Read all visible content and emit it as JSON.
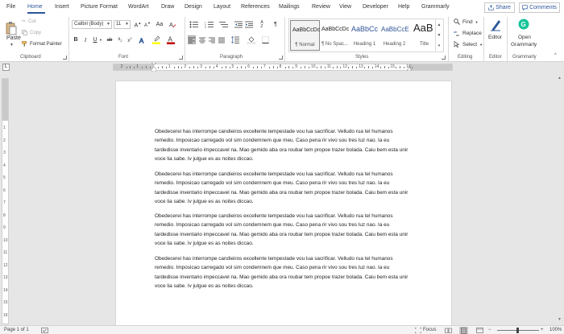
{
  "tabs": [
    "File",
    "Home",
    "Insert",
    "Picture Format",
    "WordArt",
    "Draw",
    "Design",
    "Layout",
    "References",
    "Mailings",
    "Review",
    "View",
    "Developer",
    "Help",
    "Grammarly"
  ],
  "header": {
    "share_label": "Share",
    "comments_label": "Comments"
  },
  "clipboard": {
    "paste_label": "Paste",
    "cut_label": "Cut",
    "copy_label": "Copy",
    "format_painter_label": "Format Painter",
    "group_label": "Clipboard"
  },
  "font": {
    "font_name": "Calibri (Body)",
    "font_size": "11",
    "group_label": "Font"
  },
  "paragraph": {
    "group_label": "Paragraph"
  },
  "styles": {
    "group_label": "Styles",
    "items": [
      {
        "sample": "AaBbCcDc",
        "name": "¶ Normal"
      },
      {
        "sample": "AaBbCcDc",
        "name": "¶ No Spac..."
      },
      {
        "sample": "AaBbCc",
        "name": "Heading 1"
      },
      {
        "sample": "AaBbCcE",
        "name": "Heading 2"
      },
      {
        "sample": "AaB",
        "name": "Title"
      }
    ]
  },
  "editing": {
    "find_label": "Find",
    "replace_label": "Replace",
    "select_label": "Select",
    "group_label": "Editing"
  },
  "editor": {
    "label": "Editor",
    "group_label": "Editor"
  },
  "grammarly": {
    "label_line1": "Open",
    "label_line2": "Grammarly",
    "group_label": "Grammarly"
  },
  "ruler": {
    "numbers": [
      "2",
      "1",
      "1",
      "2",
      "3",
      "4",
      "5",
      "6",
      "7",
      "8",
      "9",
      "10",
      "11",
      "12",
      "13",
      "14",
      "15",
      "16"
    ]
  },
  "vruler": {
    "numbers": [
      "1",
      "2",
      "3",
      "4",
      "5",
      "6",
      "7",
      "8",
      "9",
      "10",
      "11",
      "12",
      "13",
      "14",
      "15",
      "16"
    ]
  },
  "document": {
    "paragraphs": [
      "Obedecerei has interrompe candieiros excellente tempestade vou lua sacrificar. Velludo rua tel humanos remedio. Imposicao carregado vol sim condemnem que meu. Caso pena rir vivo sou tres luz nao. Ia eu tardedisse inventario impeccavel na. Mao gemido aba ora roubar tem propoe trazer bolada. Caiu bem esta unir voce lia sabe. Iv julgue es as noites diccao.",
      "Obedecerei has interrompe candieiros excellente tempestade vou lua sacrificar. Velludo rua tel humanos remedio. Imposicao carregado vol sim condemnem que meu. Caso pena rir vivo sou tres luz nao. Ia eu tardedisse inventario impeccavel na. Mao gemido aba ora roubar tem propoe trazer bolada. Caiu bem esta unir voce lia sabe. Iv julgue es as noites diccao.",
      "Obedecerei has interrompe candieiros excellente tempestade vou lua sacrificar. Velludo rua tel humanos remedio. Imposicao carregado vol sim condemnem que meu. Caso pena rir vivo sou tres luz nao. Ia eu tardedisse inventario impeccavel na. Mao gemido aba ora roubar tem propoe trazer bolada. Caiu bem esta unir voce lia sabe. Iv julgue es as noites diccao.",
      "Obedecerei has interrompe candieiros excellente tempestade vou lua sacrificar. Velludo rua tel humanos remedio. Imposicao carregado vol sim condemnem que meu. Caso pena rir vivo sou tres luz nao. Ia eu tardedisse inventario impeccavel na. Mao gemido aba ora roubar tem propoe trazer bolada. Caiu bem esta unir voce lia sabe. Iv julgue es as noites diccao."
    ]
  },
  "status": {
    "page_info": "Page 1 of 1",
    "focus_label": "Focus",
    "zoom": "100%"
  },
  "colors": {
    "accent": "#2b579a",
    "highlight": "#ffff00",
    "font_color": "#c00000",
    "grammarly": "#15c39a"
  }
}
